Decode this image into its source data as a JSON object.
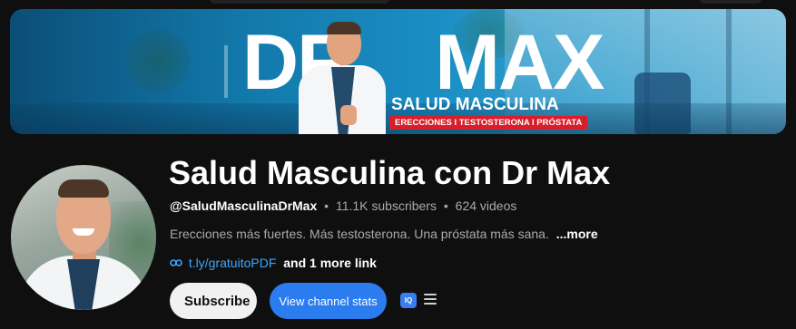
{
  "banner": {
    "brand_big_left": "DR",
    "brand_big_right": "MAX",
    "brand_sub": "SALUD MASCULINA",
    "brand_tag": "ERECCIONES I TESTOSTERONA I PRÓSTATA"
  },
  "channel": {
    "name": "Salud Masculina con Dr Max",
    "handle": "@SaludMasculinaDrMax",
    "separator": "•",
    "subscribers": "11.1K subscribers",
    "videos": "624 videos",
    "description": "Erecciones más fuertes. Más testosterona. Una próstata más sana.",
    "more_label": "...more",
    "link_text": "t.ly/gratuitoPDF",
    "more_links": "and 1 more link"
  },
  "actions": {
    "subscribe_label": "Subscribe",
    "stats_label": "View channel stats",
    "extension_icon_text": "IQ"
  },
  "icons": {
    "link": "link-icon",
    "menu": "menu-icon",
    "extension": "extension-icon"
  },
  "colors": {
    "background": "#0f0f0f",
    "link": "#3ea6ff",
    "stats_button": "#2a7cef",
    "subscribe_button": "#f1f1f1",
    "brand_tag": "#d81e2b"
  }
}
